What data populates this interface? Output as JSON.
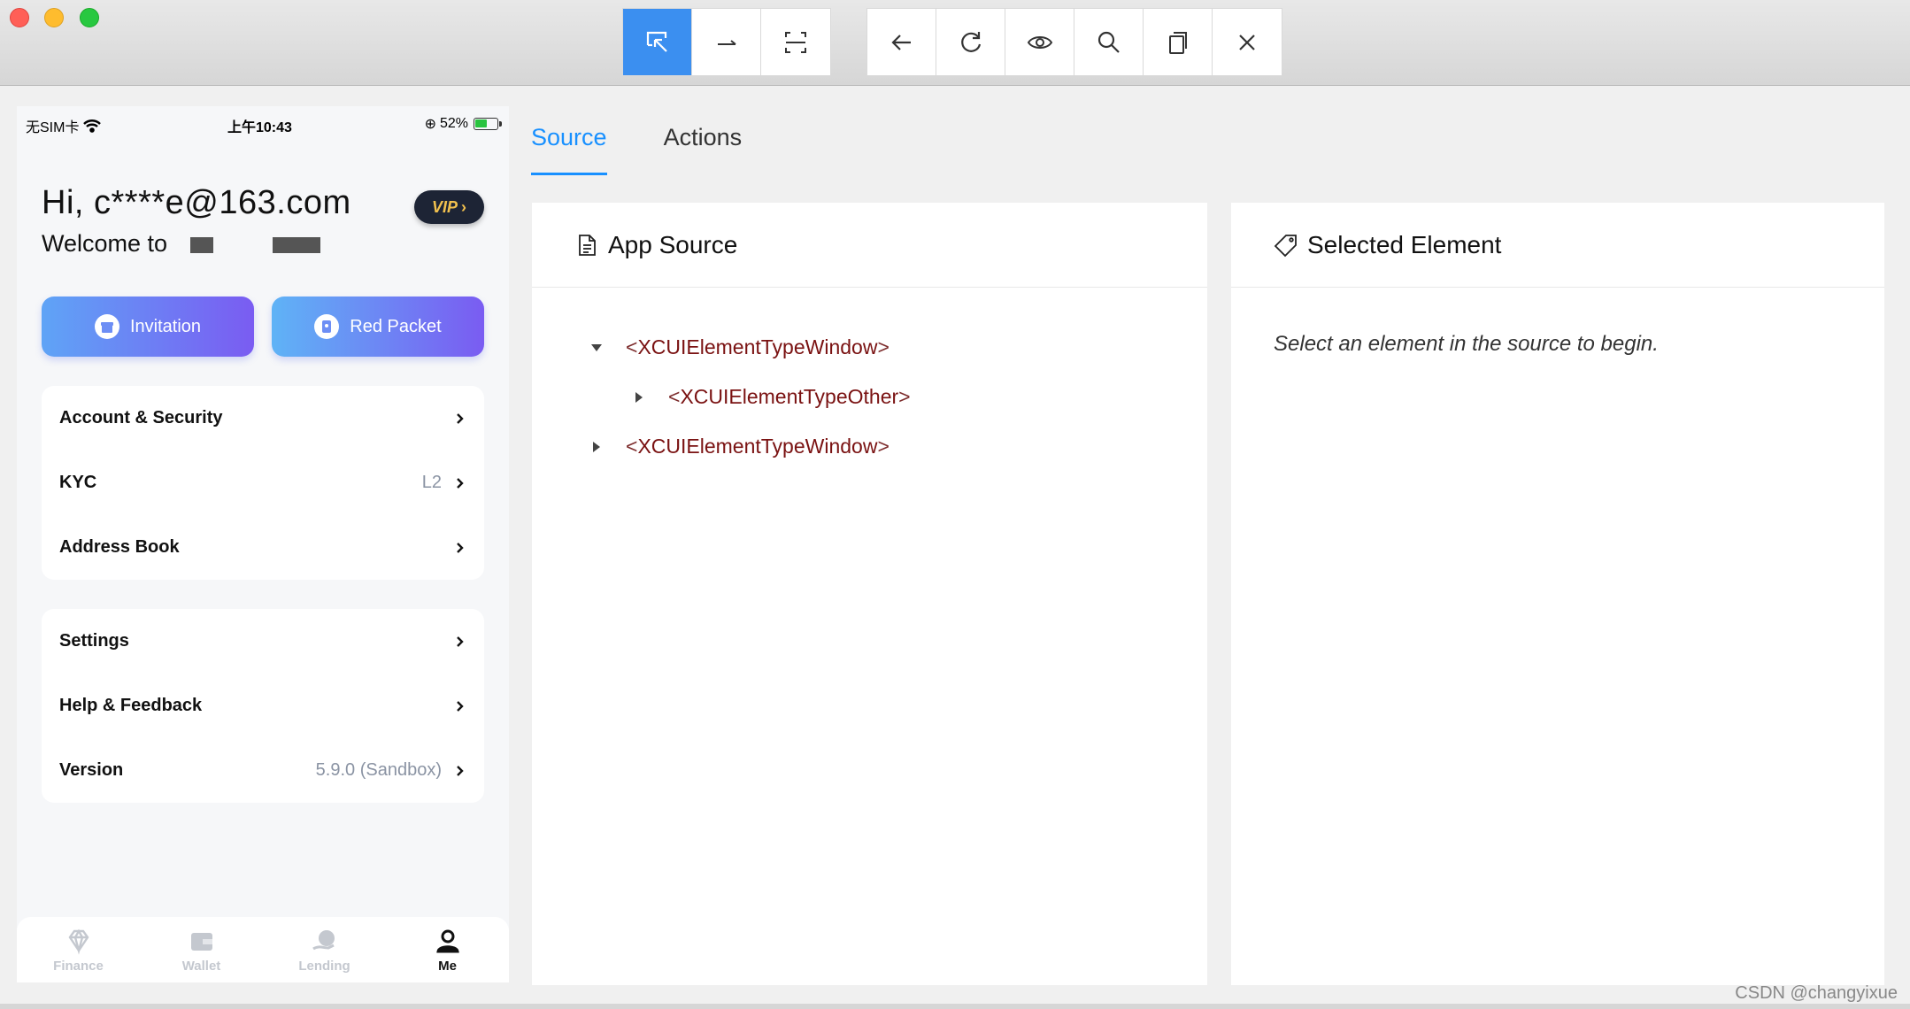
{
  "toolbar": {
    "group1": [
      {
        "name": "select-elements-icon",
        "active": true
      },
      {
        "name": "swipe-icon",
        "active": false
      },
      {
        "name": "tap-coordinates-icon",
        "active": false
      }
    ],
    "group2": [
      {
        "name": "back-icon"
      },
      {
        "name": "refresh-icon"
      },
      {
        "name": "eye-icon"
      },
      {
        "name": "search-icon"
      },
      {
        "name": "copy-icon"
      },
      {
        "name": "close-icon"
      }
    ],
    "accent_color": "#3b8ff0"
  },
  "phone": {
    "status": {
      "carrier": "无SIM卡",
      "time": "上午10:43",
      "battery": "52%"
    },
    "greeting": "Hi, c****e@163.com",
    "welcome": "Welcome to",
    "vip_label": "VIP",
    "buttons": {
      "invitation": "Invitation",
      "red_packet": "Red Packet"
    },
    "menu1": [
      {
        "label": "Account & Security",
        "value": ""
      },
      {
        "label": "KYC",
        "value": "L2"
      },
      {
        "label": "Address Book",
        "value": ""
      }
    ],
    "menu2": [
      {
        "label": "Settings",
        "value": ""
      },
      {
        "label": "Help & Feedback",
        "value": ""
      },
      {
        "label": "Version",
        "value": "5.9.0 (Sandbox)"
      }
    ],
    "tabs": [
      {
        "label": "Finance",
        "active": false
      },
      {
        "label": "Wallet",
        "active": false
      },
      {
        "label": "Lending",
        "active": false
      },
      {
        "label": "Me",
        "active": true
      }
    ]
  },
  "inspector": {
    "tabs": [
      {
        "label": "Source",
        "active": true
      },
      {
        "label": "Actions",
        "active": false
      }
    ],
    "source_title": "App Source",
    "selected_title": "Selected Element",
    "hint": "Select an element in the source to begin.",
    "tree": [
      {
        "tag": "XCUIElementTypeWindow",
        "expanded": true,
        "depth": 0
      },
      {
        "tag": "XCUIElementTypeOther",
        "expanded": false,
        "depth": 1
      },
      {
        "tag": "XCUIElementTypeWindow",
        "expanded": false,
        "depth": 0
      }
    ]
  },
  "watermark": "CSDN @changyixue"
}
